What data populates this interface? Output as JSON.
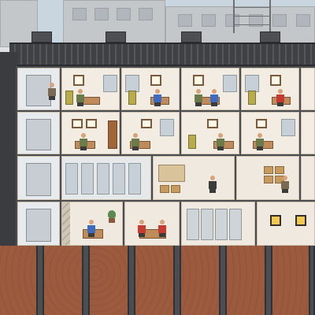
{
  "scene": {
    "name": "",
    "floors": [
      {
        "id": "floor-3",
        "rooms": [
          "elevator",
          "office",
          "office",
          "office",
          "office",
          "office"
        ]
      },
      {
        "id": "floor-2",
        "rooms": [
          "elevator",
          "office",
          "office",
          "office",
          "office",
          "office"
        ]
      },
      {
        "id": "floor-1",
        "rooms": [
          "elevator",
          "security",
          "storage",
          "mailroom"
        ]
      },
      {
        "id": "floor-0",
        "rooms": [
          "elevator",
          "break-room",
          "break-room",
          "lockers",
          "generator"
        ]
      }
    ],
    "icons": [
      "elevator-icon",
      "desk-icon",
      "filing-cabinet-icon",
      "window-icon",
      "plant-icon",
      "box-icon",
      "locker-icon",
      "generator-icon",
      "hvac-unit-icon",
      "pillar-icon",
      "worker-icon"
    ],
    "colors": {
      "roof": "#3f4144",
      "room_wall": "#efe9df",
      "room_border": "#cbbfae",
      "wood": "#a1653a",
      "cabinet": "#b7ab4b",
      "ground": "#9c5b3f",
      "pillar": "#4a4d52",
      "worker_red": "#c73a2f",
      "worker_blue": "#3f6bbf",
      "worker_green": "#6b7b4a"
    }
  }
}
